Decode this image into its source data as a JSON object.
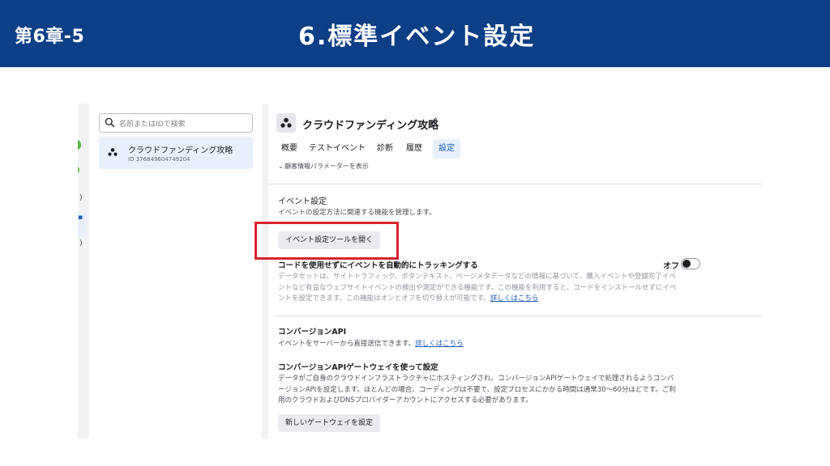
{
  "header": {
    "chapter": "第6章-5",
    "title": "6.標準イベント設定"
  },
  "sidebar": {
    "search_placeholder": "名前またはIDで検索",
    "items": [
      {
        "name": "クラウドファンディング攻略",
        "id": "ID 376849604749204"
      }
    ]
  },
  "dataset": {
    "title": "クラウドファンディング攻略",
    "tabs": [
      {
        "label": "概要"
      },
      {
        "label": "テストイベント"
      },
      {
        "label": "診断"
      },
      {
        "label": "履歴"
      },
      {
        "label": "設定",
        "active": true
      }
    ],
    "expander_label": "顧客情報パラメーターを表示"
  },
  "event_settings": {
    "title": "イベント設定",
    "description": "イベントの設定方法に関連する機能を管理します。",
    "open_tool_button": "イベント設定ツールを開く"
  },
  "auto_tracking": {
    "title": "コードを使用せずにイベントを自動的にトラッキングする",
    "toggle_label": "オフ",
    "toggle_on": false,
    "description_lines": [
      "データセットは、サイトトラフィック、ボタンテキスト、ページメタデータなどの情報に基づいて、購入イベントや登録完了イベ",
      "ントなど有益なウェブサイトイベントの検出や測定ができる機能です。この機能を利用すると、コードをインストールせずにイベ",
      "ントを設定できます。この機能はオンとオフを切り替えが可能です。"
    ],
    "link": "詳しくはこちら"
  },
  "conversion_api": {
    "title": "コンバージョンAPI",
    "description": "イベントをサーバーから直接送信できます。",
    "link": "詳しくはこちら"
  },
  "capi_gateway": {
    "title": "コンバージョンAPIゲートウェイを使って設定",
    "description_lines": [
      "データがご自身のクラウドインフラストラクチャにホスティングされ、コンバージョンAPIゲートウェイで処理されるようコンバ",
      "ージョンAPIを設定します。ほとんどの場合、コーディングは不要で、設定プロセスにかかる時間は通常30〜60分ほどです。ご利",
      "用のクラウドおよびDNSプロバイダーアカウントにアクセスする必要があります。"
    ],
    "new_gateway_button": "新しいゲートウェイを設定"
  },
  "colors": {
    "header_bg": "#0d3f86",
    "highlight": "#d8242b",
    "link": "#1b5bb8",
    "selected_bg": "#e7f0fb",
    "rail_green": "#58b947"
  }
}
